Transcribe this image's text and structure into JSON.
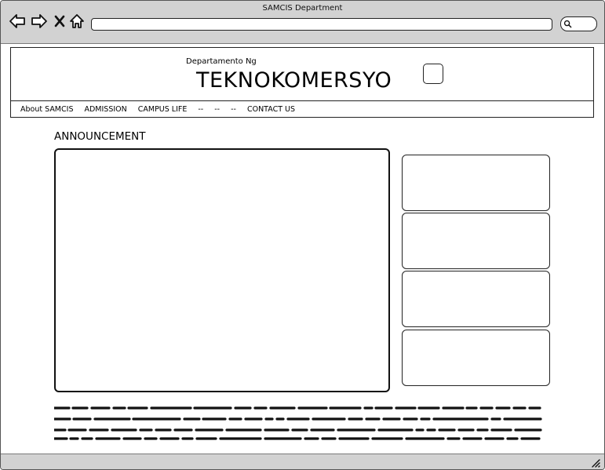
{
  "window": {
    "title": "SAMCIS Department"
  },
  "browser": {
    "back_icon": "arrow-left-icon",
    "forward_icon": "arrow-right-icon",
    "stop_icon": "close-icon",
    "home_icon": "home-icon",
    "search_icon": "search-icon",
    "address_value": ""
  },
  "header": {
    "subtitle": "Departamento Ng",
    "title": "TEKNOKOMERSYO"
  },
  "menu": {
    "items": [
      "About SAMCIS",
      "ADMISSION",
      "CAMPUS LIFE",
      "--",
      "--",
      "--",
      "CONTACT US"
    ]
  },
  "main": {
    "section_title": "ANNOUNCEMENT"
  }
}
